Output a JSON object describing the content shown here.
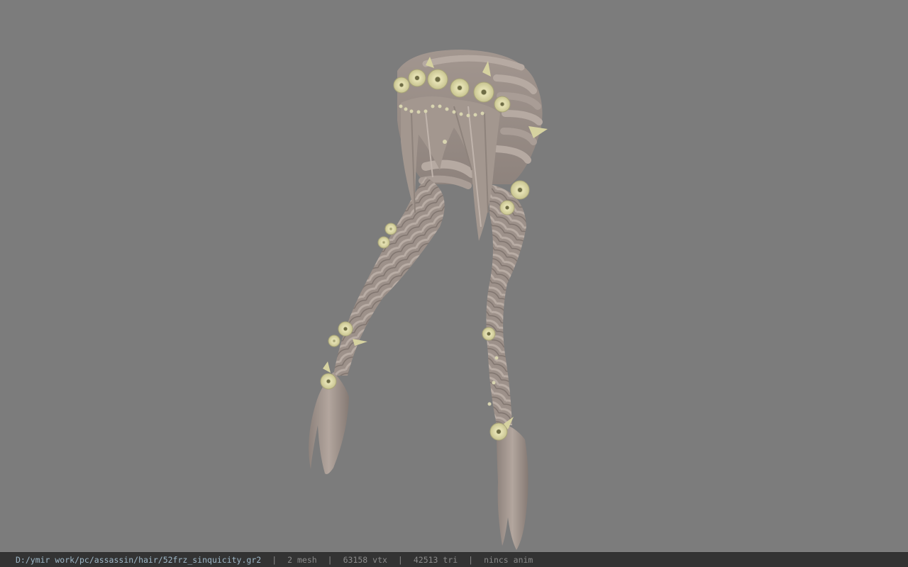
{
  "status_bar": {
    "file_path": "D:/ymir work/pc/assassin/hair/52frz_sinquicity.gr2",
    "separator": "|",
    "mesh_count": "2 mesh",
    "vertex_count": "63158 vtx",
    "triangle_count": "42513 tri",
    "anim_status": "nincs anim"
  },
  "viewport": {
    "background_color": "#7c7c7c",
    "model_subject": "hair-braids-with-flowers",
    "hair_color": "#a89b94",
    "flower_color": "#dcd8a4"
  }
}
